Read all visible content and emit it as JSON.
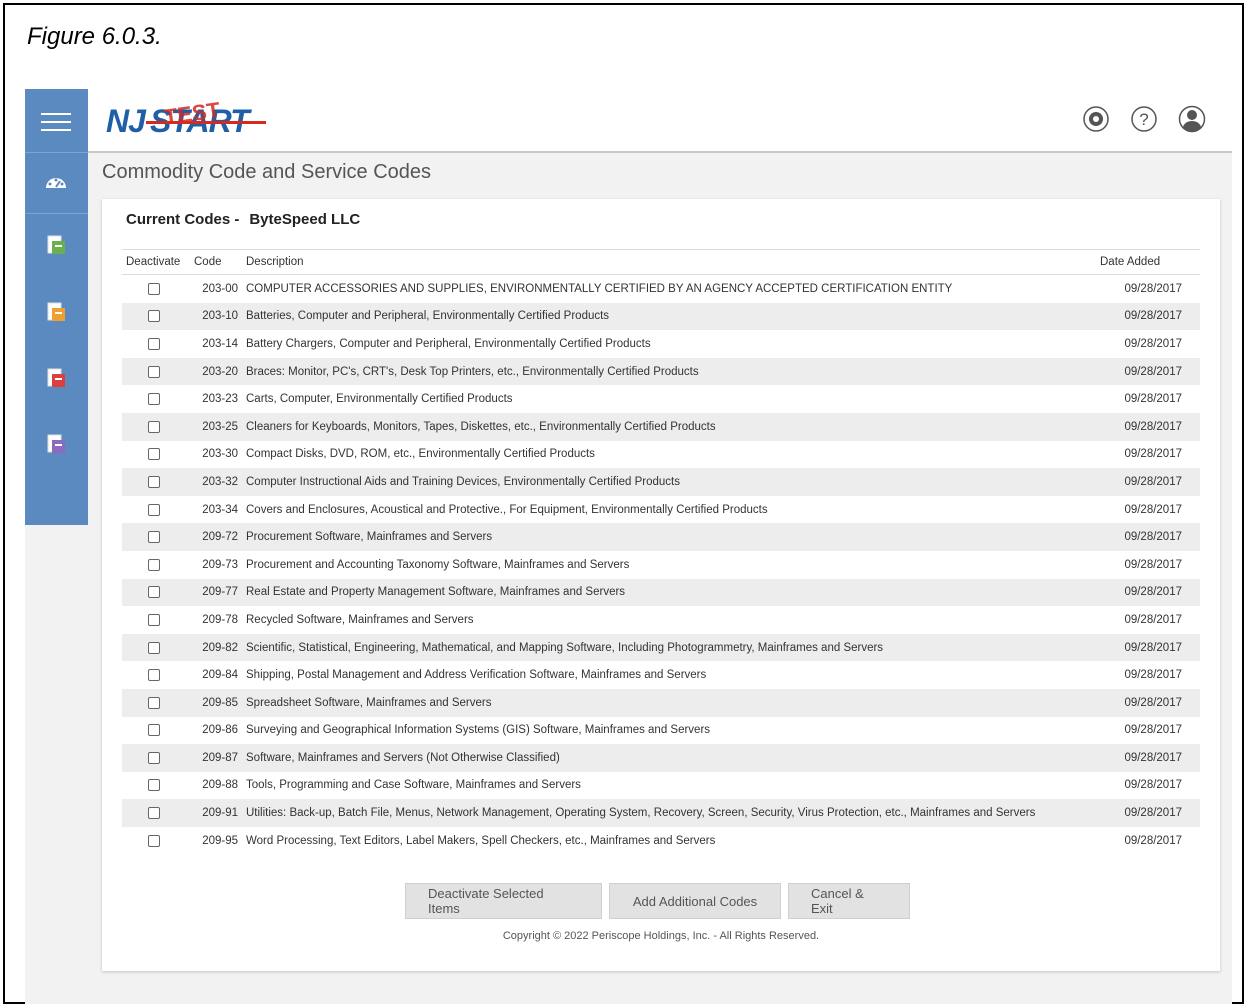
{
  "figure_caption": "Figure 6.0.3.",
  "header": {
    "logo_text_main": "NJ",
    "logo_text_start": "START",
    "logo_text_overlay": "TEST",
    "icons": [
      "gear-icon",
      "help-icon",
      "user-icon"
    ]
  },
  "sidebar": {
    "icons": [
      "hamburger-icon",
      "dashboard-icon",
      "green-document-icon",
      "orange-document-icon",
      "red-document-icon",
      "purple-document-icon"
    ]
  },
  "page": {
    "title": "Commodity Code and Service Codes",
    "current_codes_label": "Current Codes -",
    "vendor_name": "ByteSpeed LLC"
  },
  "table": {
    "headers": {
      "deactivate": "Deactivate",
      "code": "Code",
      "description": "Description",
      "date_added": "Date Added"
    },
    "rows": [
      {
        "code": "203-00",
        "description": "COMPUTER ACCESSORIES AND SUPPLIES, ENVIRONMENTALLY CERTIFIED BY AN AGENCY ACCEPTED CERTIFICATION ENTITY",
        "date": "09/28/2017"
      },
      {
        "code": "203-10",
        "description": "Batteries, Computer and Peripheral, Environmentally Certified Products",
        "date": "09/28/2017"
      },
      {
        "code": "203-14",
        "description": "Battery Chargers, Computer and Peripheral, Environmentally Certified Products",
        "date": "09/28/2017"
      },
      {
        "code": "203-20",
        "description": "Braces: Monitor, PC's, CRT's, Desk Top Printers, etc., Environmentally Certified Products",
        "date": "09/28/2017"
      },
      {
        "code": "203-23",
        "description": "Carts, Computer, Environmentally Certified Products",
        "date": "09/28/2017"
      },
      {
        "code": "203-25",
        "description": "Cleaners for Keyboards, Monitors, Tapes, Diskettes, etc., Environmentally Certified Products",
        "date": "09/28/2017"
      },
      {
        "code": "203-30",
        "description": "Compact Disks, DVD, ROM, etc., Environmentally Certified Products",
        "date": "09/28/2017"
      },
      {
        "code": "203-32",
        "description": "Computer Instructional Aids and Training Devices, Environmentally Certified Products",
        "date": "09/28/2017"
      },
      {
        "code": "203-34",
        "description": "Covers and Enclosures, Acoustical and Protective., For Equipment, Environmentally Certified Products",
        "date": "09/28/2017"
      },
      {
        "code": "209-72",
        "description": "Procurement Software, Mainframes and Servers",
        "date": "09/28/2017"
      },
      {
        "code": "209-73",
        "description": "Procurement and Accounting Taxonomy Software, Mainframes and Servers",
        "date": "09/28/2017"
      },
      {
        "code": "209-77",
        "description": "Real Estate and Property Management Software, Mainframes and Servers",
        "date": "09/28/2017"
      },
      {
        "code": "209-78",
        "description": "Recycled Software, Mainframes and Servers",
        "date": "09/28/2017"
      },
      {
        "code": "209-82",
        "description": "Scientific, Statistical, Engineering, Mathematical, and Mapping Software, Including Photogrammetry, Mainframes and Servers",
        "date": "09/28/2017"
      },
      {
        "code": "209-84",
        "description": "Shipping, Postal Management and Address Verification Software, Mainframes and Servers",
        "date": "09/28/2017"
      },
      {
        "code": "209-85",
        "description": "Spreadsheet Software, Mainframes and Servers",
        "date": "09/28/2017"
      },
      {
        "code": "209-86",
        "description": "Surveying and Geographical Information Systems (GIS) Software, Mainframes and Servers",
        "date": "09/28/2017"
      },
      {
        "code": "209-87",
        "description": "Software, Mainframes and Servers (Not Otherwise Classified)",
        "date": "09/28/2017"
      },
      {
        "code": "209-88",
        "description": "Tools, Programming and Case Software, Mainframes and Servers",
        "date": "09/28/2017"
      },
      {
        "code": "209-91",
        "description": "Utilities: Back-up, Batch File, Menus, Network Management, Operating System, Recovery, Screen, Security, Virus Protection, etc., Mainframes and Servers",
        "date": "09/28/2017"
      },
      {
        "code": "209-95",
        "description": "Word Processing, Text Editors, Label Makers, Spell Checkers, etc., Mainframes and Servers",
        "date": "09/28/2017"
      }
    ]
  },
  "buttons": {
    "deactivate": "Deactivate Selected Items",
    "add": "Add Additional Codes",
    "cancel": "Cancel & Exit"
  },
  "footer": {
    "copyright": "Copyright © 2022 Periscope Holdings, Inc. - All Rights Reserved."
  },
  "colors": {
    "sidebar": "#5b8ac0",
    "brand_blue": "#1f5fa8",
    "test_red": "#d42a20",
    "row_alt": "#ededed",
    "button_bg": "#e2e2e2"
  }
}
